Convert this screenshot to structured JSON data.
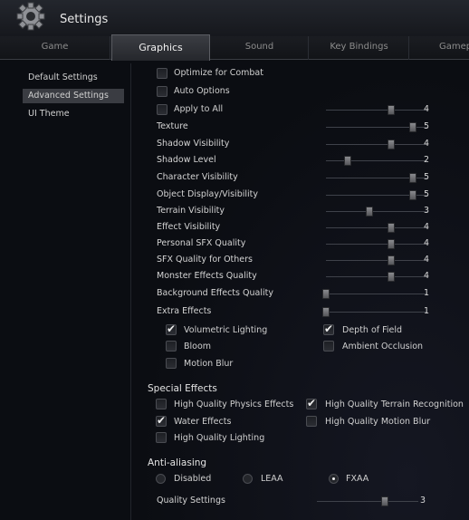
{
  "window": {
    "title": "Settings"
  },
  "tabs": [
    {
      "label": "Game",
      "active": false
    },
    {
      "label": "Graphics",
      "active": true
    },
    {
      "label": "Sound",
      "active": false
    },
    {
      "label": "Key Bindings",
      "active": false
    },
    {
      "label": "Gamep",
      "active": false
    }
  ],
  "sidebar": {
    "items": [
      {
        "label": "Default Settings",
        "selected": false
      },
      {
        "label": "Advanced Settings",
        "selected": true
      },
      {
        "label": "UI Theme",
        "selected": false
      }
    ]
  },
  "top_options": [
    {
      "label": "Optimize for Combat",
      "checked": false
    },
    {
      "label": "Auto Options",
      "checked": false
    },
    {
      "label": "Apply to All",
      "checked": false
    }
  ],
  "apply_all_value": "4",
  "sliders": [
    {
      "label": "Texture",
      "value": "5"
    },
    {
      "label": "Shadow Visibility",
      "value": "4"
    },
    {
      "label": "Shadow Level",
      "value": "2"
    },
    {
      "label": "Character Visibility",
      "value": "5"
    },
    {
      "label": "Object Display/Visibility",
      "value": "5"
    },
    {
      "label": "Terrain Visibility",
      "value": "3"
    },
    {
      "label": "Effect Visibility",
      "value": "4"
    },
    {
      "label": "Personal SFX Quality",
      "value": "4"
    },
    {
      "label": "SFX Quality for Others",
      "value": "4"
    },
    {
      "label": "Monster Effects Quality",
      "value": "4"
    },
    {
      "label": "Background Effects Quality",
      "value": "1"
    },
    {
      "label": "Extra Effects",
      "value": "1"
    }
  ],
  "extra_effects": [
    {
      "label": "Volumetric Lighting",
      "checked": true
    },
    {
      "label": "Depth of Field",
      "checked": true
    },
    {
      "label": "Bloom",
      "checked": false
    },
    {
      "label": "Ambient Occlusion",
      "checked": false
    },
    {
      "label": "Motion Blur",
      "checked": false
    }
  ],
  "special_effects": {
    "title": "Special Effects",
    "items": [
      {
        "label": "High Quality Physics Effects",
        "checked": false
      },
      {
        "label": "High Quality Terrain Recognition",
        "checked": true
      },
      {
        "label": "Water Effects",
        "checked": true
      },
      {
        "label": "High Quality Motion Blur",
        "checked": false
      },
      {
        "label": "High Quality Lighting",
        "checked": false
      }
    ]
  },
  "anti_aliasing": {
    "title": "Anti-aliasing",
    "options": [
      {
        "label": "Disabled",
        "selected": false
      },
      {
        "label": "LEAA",
        "selected": false
      },
      {
        "label": "FXAA",
        "selected": true
      }
    ]
  },
  "quality_settings": {
    "label": "Quality Settings",
    "value": "3"
  }
}
